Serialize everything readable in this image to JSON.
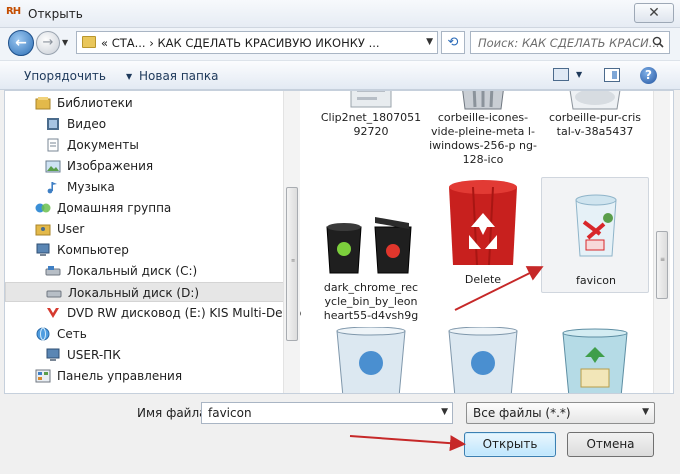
{
  "window": {
    "title": "Открыть",
    "app_icon_text": "RH",
    "close_glyph": "✕"
  },
  "nav": {
    "back_glyph": "←",
    "forward_glyph": "→",
    "address": "« СТА...  ›  КАК СДЕЛАТЬ КРАСИВУЮ ИКОНКУ ...",
    "search_placeholder": "Поиск: КАК СДЕЛАТЬ КРАСИ...",
    "refresh_glyph": "⟲"
  },
  "toolbar": {
    "organize_label": "Упорядочить",
    "new_folder_label": "Новая папка",
    "help_glyph": "?"
  },
  "tree": {
    "items": [
      {
        "label": "Библиотеки",
        "icon": "library-icon"
      },
      {
        "label": "Видео",
        "icon": "video-icon"
      },
      {
        "label": "Документы",
        "icon": "documents-icon"
      },
      {
        "label": "Изображения",
        "icon": "pictures-icon"
      },
      {
        "label": "Музыка",
        "icon": "music-icon"
      },
      {
        "label": "Домашняя группа",
        "icon": "homegroup-icon"
      },
      {
        "label": "User",
        "icon": "user-folder-icon"
      },
      {
        "label": "Компьютер",
        "icon": "computer-icon"
      },
      {
        "label": "Локальный диск (C:)",
        "icon": "drive-icon"
      },
      {
        "label": "Локальный диск (D:)",
        "icon": "drive-icon"
      },
      {
        "label": "DVD RW дисковод (E:) KIS Multi-Device",
        "icon": "dvd-icon"
      },
      {
        "label": "Сеть",
        "icon": "network-icon"
      },
      {
        "label": "USER-ПК",
        "icon": "pc-icon"
      },
      {
        "label": "Панель управления",
        "icon": "control-panel-icon"
      }
    ]
  },
  "files": {
    "tiles": [
      {
        "label": "Clip2net_1807051 92720"
      },
      {
        "label": "corbeille-icones-vide-pleine-meta l-iwindows-256-p ng-128-ico"
      },
      {
        "label": "corbeille-pur-cris tal-v-38a5437"
      },
      {
        "label": "dark_chrome_rec ycle_bin_by_leon heart55-d4vsh9g"
      },
      {
        "label": "Delete"
      },
      {
        "label": "favicon"
      },
      {
        "label": ""
      },
      {
        "label": ""
      },
      {
        "label": ""
      }
    ]
  },
  "footer": {
    "filename_label": "Имя файла:",
    "filename_value": "favicon",
    "filetype_value": "Все файлы (*.*)",
    "open_label": "Открыть",
    "cancel_label": "Отмена"
  },
  "colors": {
    "accent": "#3c7fb1",
    "annotation_arrow": "#c62828",
    "selection": "#e6e6e6"
  }
}
